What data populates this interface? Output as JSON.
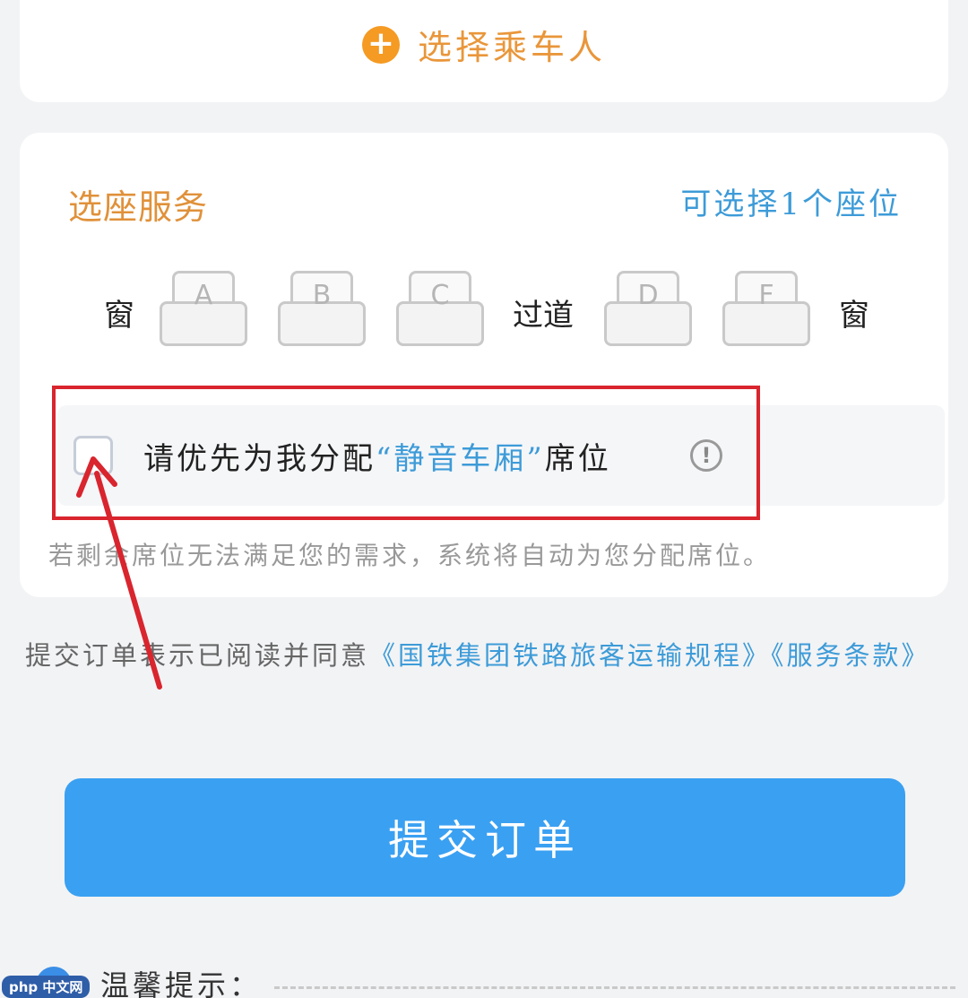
{
  "passenger": {
    "add_label": "选择乘车人"
  },
  "seat_service": {
    "title": "选座服务",
    "available": "可选择1个座位",
    "row": {
      "left_window": "窗",
      "aisle": "过道",
      "right_window": "窗",
      "seats": [
        "A",
        "B",
        "C",
        "D",
        "F"
      ]
    },
    "quiet_car": {
      "prefix": "请优先为我分配",
      "highlight": "“静音车厢”",
      "suffix": "席位",
      "info_glyph": "!"
    },
    "note": "若剩余席位无法满足您的需求，系统将自动为您分配席位。"
  },
  "agreement": {
    "prefix": "提交订单表示已阅读并同意",
    "link_rules": "《国铁集团铁路旅客运输规程》",
    "link_terms": "《服务条款》"
  },
  "submit": {
    "label": "提交订单"
  },
  "tips": {
    "label": "温馨提示："
  },
  "watermark": {
    "label": "php 中文网"
  },
  "colors": {
    "accent_orange": "#e9963a",
    "link_blue": "#3d9bd8",
    "button_blue": "#3aa0f2",
    "annotation_red": "#d9252e"
  }
}
